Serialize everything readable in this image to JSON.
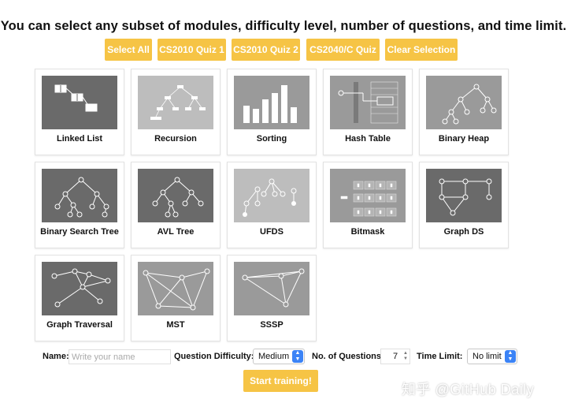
{
  "headline": "You can select any subset of modules, difficulty level, number of questions, and time limit.",
  "buttons": {
    "select_all": "Select All",
    "quiz_cs2010_1": "CS2010 Quiz 1",
    "quiz_cs2010_2": "CS2010 Quiz 2",
    "quiz_cs2040c": "CS2040/C Quiz",
    "clear_selection": "Clear Selection"
  },
  "modules": [
    {
      "label": "Linked List",
      "icon": "linked-list-icon"
    },
    {
      "label": "Recursion",
      "icon": "recursion-tree-icon"
    },
    {
      "label": "Sorting",
      "icon": "bar-sort-icon"
    },
    {
      "label": "Hash Table",
      "icon": "hash-table-icon"
    },
    {
      "label": "Binary Heap",
      "icon": "binary-heap-icon"
    },
    {
      "label": "Binary Search Tree",
      "icon": "bst-icon"
    },
    {
      "label": "AVL Tree",
      "icon": "avl-tree-icon"
    },
    {
      "label": "UFDS",
      "icon": "ufds-icon"
    },
    {
      "label": "Bitmask",
      "icon": "bitmask-icon"
    },
    {
      "label": "Graph DS",
      "icon": "graph-ds-icon"
    },
    {
      "label": "Graph Traversal",
      "icon": "graph-traversal-icon"
    },
    {
      "label": "MST",
      "icon": "mst-icon"
    },
    {
      "label": "SSSP",
      "icon": "sssp-icon"
    }
  ],
  "form": {
    "name_label": "Name:",
    "name_placeholder": "Write your name",
    "difficulty_label": "Question Difficulty:",
    "difficulty_value": "Medium",
    "num_questions_label": "No. of Questions:",
    "num_questions_value": "7",
    "time_limit_label": "Time Limit:",
    "time_limit_value": "No limit"
  },
  "start_button": "Start training!",
  "watermark": "知乎 @GitHub Daily",
  "colors": {
    "accent": "#f6c445",
    "select_arrow": "#3b83f6",
    "thumb_dark": "#6a6a6a",
    "thumb_mid": "#9a9a9a",
    "thumb_light": "#bdbdbd"
  }
}
